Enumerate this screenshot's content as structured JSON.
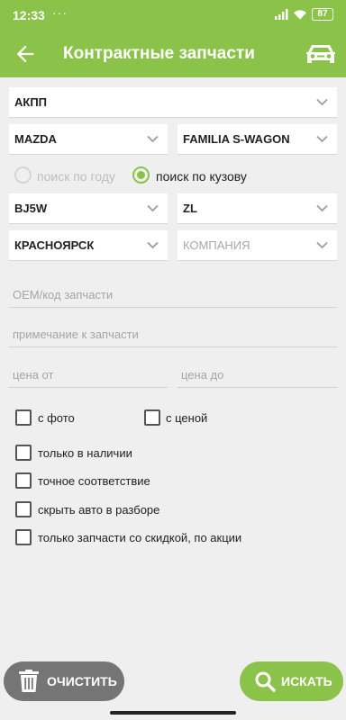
{
  "status_bar": {
    "time": "12:33",
    "more": "···",
    "battery": "87"
  },
  "app_bar": {
    "title": "Контрактные запчасти"
  },
  "form": {
    "transmission": "АКПП",
    "make": "MAZDA",
    "model": "FAMILIA S-WAGON",
    "search_mode": {
      "by_year_label": "поиск по году",
      "by_body_label": "поиск по кузову",
      "selected": "by_body"
    },
    "body": "BJ5W",
    "engine": "ZL",
    "city": "КРАСНОЯРСК",
    "company_placeholder": "КОМПАНИЯ",
    "oem_placeholder": "OEM/код запчасти",
    "note_placeholder": "примечание к запчасти",
    "price_from_placeholder": "цена от",
    "price_to_placeholder": "цена до",
    "checks": {
      "with_photo": "с фото",
      "with_price": "с ценой",
      "in_stock": "только в наличии",
      "exact_match": "точное соответствие",
      "hide_dismantling": "скрыть авто в разборе",
      "discount_only": "только запчасти со скидкой, по акции"
    }
  },
  "actions": {
    "clear_label": "ОЧИСТИТЬ",
    "search_label": "ИСКАТЬ"
  },
  "colors": {
    "accent": "#8bc34a",
    "clear_button": "#757575",
    "background": "#efefef"
  }
}
